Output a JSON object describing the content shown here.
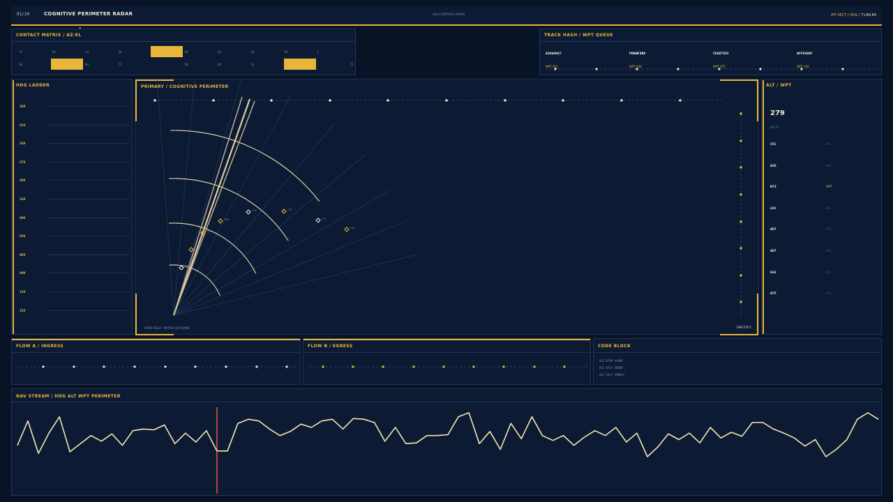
{
  "header": {
    "counter": "01/10",
    "title": "COGNITIVE PERIMETER RADAR",
    "center_label": "ADI CONTROL PANEL",
    "right_prefix": "PPI SECT / HDG / ",
    "right_time": "T+80.84"
  },
  "contact_matrix": {
    "title": "CONTACT MATRIX / AZ-EL",
    "row1": [
      "72",
      "20",
      "14",
      "26",
      "",
      "00",
      "33",
      "34",
      "76",
      "2"
    ],
    "row2": [
      "38",
      "",
      "94",
      "71",
      "",
      "58",
      "66",
      "31",
      "1",
      "",
      "71"
    ]
  },
  "track_hash": {
    "title": "TRACK HASH / WPT QUEUE",
    "hashes": [
      "A29dd047",
      "FD8AF388",
      "C8687553",
      "AFF8380F"
    ],
    "wpts": [
      "WPT 011",
      "WPT 026",
      "WPT 075",
      "WPT 145"
    ]
  },
  "hdg_ladder": {
    "title": "HDG LADDER",
    "values": [
      "180",
      "210",
      "240",
      "270",
      "300",
      "330",
      "000",
      "030",
      "060",
      "090",
      "120",
      "150"
    ]
  },
  "primary": {
    "title": "PRIMARY / COGNITIVE PERIMETER",
    "footer_left": "OPEN FIELD · MATRIX ON FRAME",
    "footer_right": "SHP 276.7",
    "contacts": [
      "C09",
      "C14",
      "C21",
      "C08",
      "C16",
      "C31",
      "C27",
      "C05"
    ]
  },
  "alt_wpt": {
    "title": "ALT / WPT",
    "big_value": "279",
    "sub_label": "ALT FL",
    "rows": [
      {
        "id": "C51",
        "v": "NUL"
      },
      {
        "id": "A26",
        "v": "NUL"
      },
      {
        "id": "B73",
        "v": "WPT"
      },
      {
        "id": "L93",
        "v": "NUL"
      },
      {
        "id": "A07",
        "v": "NUL"
      },
      {
        "id": "A67",
        "v": "NUL"
      },
      {
        "id": "E63",
        "v": "NUL"
      },
      {
        "id": "A75",
        "v": "NUL"
      }
    ]
  },
  "flow_a": {
    "title": "FLOW A / INGRESS"
  },
  "flow_b": {
    "title": "FLOW B / EGRESS"
  },
  "code_block": {
    "title": "CODE BLOCK",
    "lines": [
      "AGI-8789 4G808",
      "AGI-8767 4BDDD",
      "AGI-5427 290647"
    ]
  },
  "nav_stream": {
    "title": "NAV STREAM / HDG ALT WPT PERIMETER",
    "chart_data": {
      "type": "line",
      "series": [
        {
          "values": [
            40,
            10,
            50,
            25,
            5,
            48,
            38,
            28,
            35,
            26,
            40,
            22,
            20,
            21,
            15,
            38,
            25,
            36,
            22,
            47,
            47,
            13,
            8,
            10,
            20,
            28,
            23,
            14,
            18,
            10,
            8,
            20,
            7,
            8,
            12,
            35,
            18,
            38,
            37,
            28,
            28,
            27,
            5,
            0,
            38,
            23,
            45,
            13,
            32,
            5,
            28,
            34,
            28,
            40,
            30,
            22,
            28,
            18,
            36,
            25,
            54,
            42,
            26,
            33,
            25,
            37,
            18,
            31,
            24,
            29,
            12,
            12,
            20,
            25,
            31,
            41,
            33,
            54,
            45,
            33,
            8,
            0,
            8
          ]
        }
      ],
      "marker_index": 19,
      "ylim": [
        0,
        60
      ]
    }
  },
  "colors": {
    "accent": "#e8b63a",
    "panel": "#0c1b33",
    "border": "#22365a",
    "trace": "#f5e6b4",
    "marker": "#e0523a"
  }
}
